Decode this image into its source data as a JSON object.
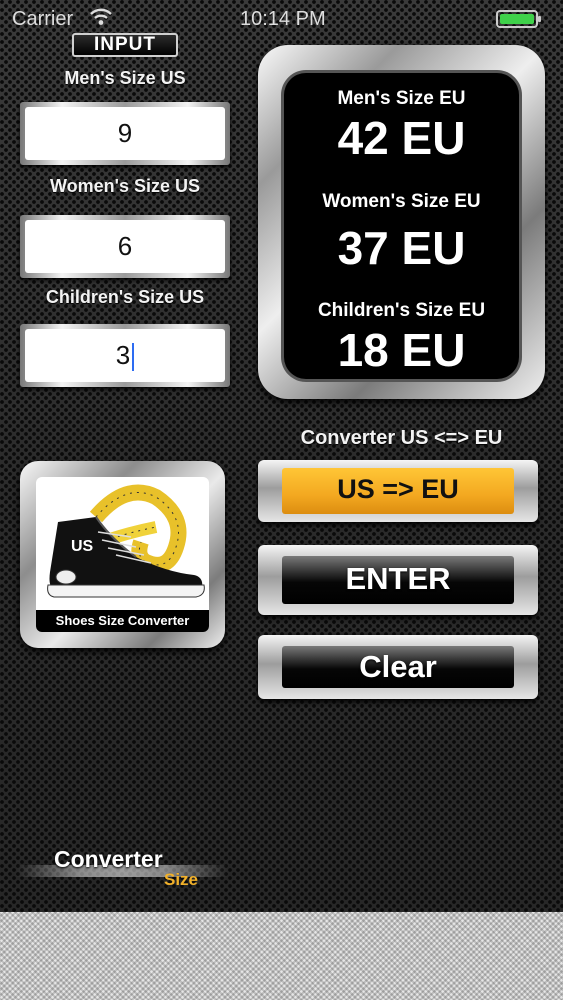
{
  "status_bar": {
    "carrier": "Carrier",
    "time": "10:14 PM"
  },
  "input_panel": {
    "badge": "INPUT",
    "mens_label": "Men's Size US",
    "mens_value": "9",
    "womens_label": "Women's Size US",
    "womens_value": "6",
    "childrens_label": "Children's Size US",
    "childrens_value": "3"
  },
  "results": {
    "mens_label": "Men's Size EU",
    "mens_value": "42 EU",
    "womens_label": "Women's Size EU",
    "womens_value": "37 EU",
    "childrens_label": "Children's Size EU",
    "childrens_value": "18 EU"
  },
  "logo": {
    "badge_text": "US",
    "caption": "Shoes Size Converter"
  },
  "controls": {
    "converter_label": "Converter US <=> EU",
    "direction_button": "US => EU",
    "enter_button": "ENTER",
    "clear_button": "Clear"
  },
  "brand": {
    "main": "Converter",
    "sub": "Size"
  },
  "colors": {
    "accent_yellow": "#f3a820",
    "battery_green": "#3fd14a",
    "caret_blue": "#2d6cf2"
  }
}
